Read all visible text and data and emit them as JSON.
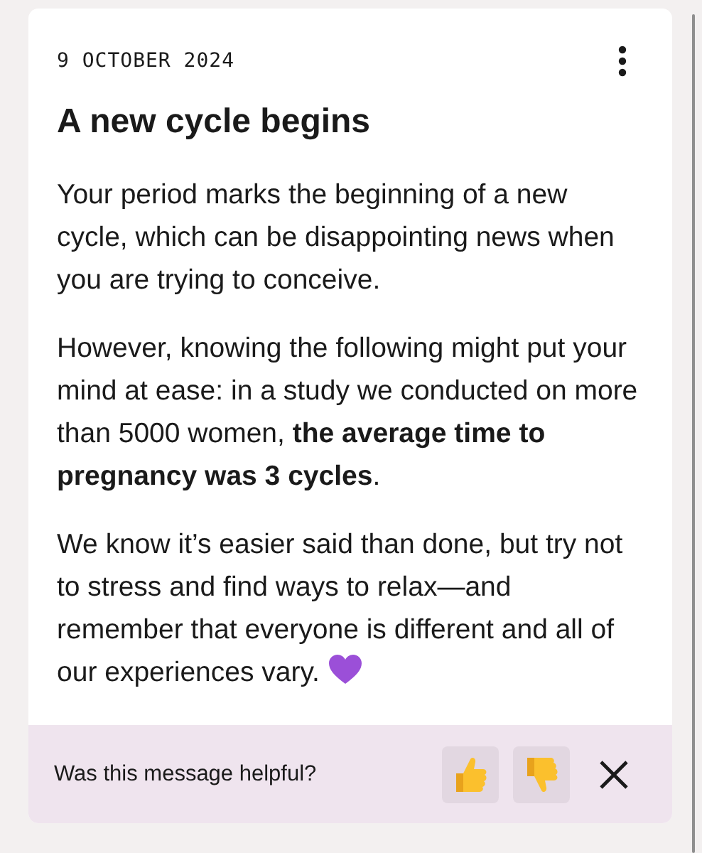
{
  "card": {
    "date": "9 OCTOBER 2024",
    "title": "A new cycle begins",
    "paragraphs": [
      "Your period marks the beginning of a new cycle, which can be disappointing news when you are trying to conceive.",
      "However, knowing the following might put your mind at ease: in a study we conducted on more than 5000 women, **the average time to pregnancy was 3 cycles**.",
      "We know it’s easier said than done, but try not to stress and find ways to relax—and remember that everyone is different and all of our experiences vary."
    ]
  },
  "feedback": {
    "question": "Was this message helpful?"
  }
}
